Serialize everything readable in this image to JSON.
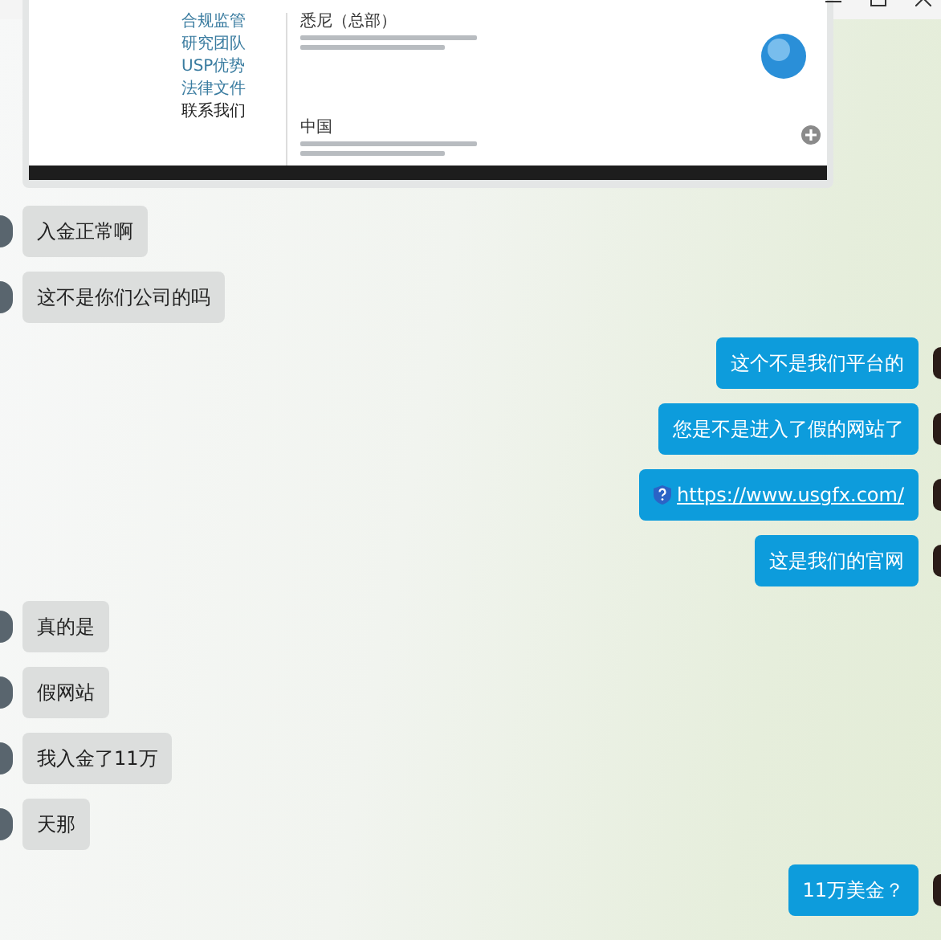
{
  "shared_image": {
    "nav_links": [
      {
        "label": "合规监管",
        "selected": false
      },
      {
        "label": "研究团队",
        "selected": false
      },
      {
        "label": "USP优势",
        "selected": false
      },
      {
        "label": "法律文件",
        "selected": false
      },
      {
        "label": "联系我们",
        "selected": true
      }
    ],
    "offices": [
      {
        "name": "悉尼（总部）"
      },
      {
        "name": "中国"
      }
    ]
  },
  "messages": [
    {
      "outgoing": false,
      "kind": "text",
      "text": "入金正常啊"
    },
    {
      "outgoing": false,
      "kind": "text",
      "text": "这不是你们公司的吗"
    },
    {
      "outgoing": true,
      "kind": "text",
      "text": "这个不是我们平台的"
    },
    {
      "outgoing": true,
      "kind": "text",
      "text": "您是不是进入了假的网站了"
    },
    {
      "outgoing": true,
      "kind": "link",
      "text": "https://www.usgfx.com/"
    },
    {
      "outgoing": true,
      "kind": "text",
      "text": "这是我们的官网"
    },
    {
      "outgoing": false,
      "kind": "text",
      "text": "真的是"
    },
    {
      "outgoing": false,
      "kind": "text",
      "text": "假网站"
    },
    {
      "outgoing": false,
      "kind": "text",
      "text": "我入金了11万"
    },
    {
      "outgoing": false,
      "kind": "text",
      "text": "天那"
    },
    {
      "outgoing": true,
      "kind": "text",
      "text": "11万美金？"
    }
  ]
}
